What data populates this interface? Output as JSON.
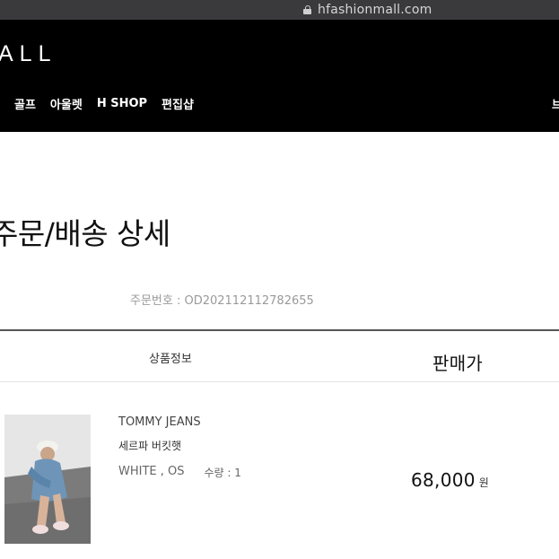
{
  "browser": {
    "url": "hfashionmall.com"
  },
  "header": {
    "logo": "ALL",
    "nav": [
      "골프",
      "아울렛",
      "H SHOP",
      "편집샵"
    ],
    "nav_right": "브"
  },
  "page": {
    "title": "주문/배송 상세",
    "order_number": "주문번호 : OD202112112782655"
  },
  "table": {
    "headers": {
      "product_info": "상품정보",
      "price": "판매가"
    }
  },
  "item": {
    "brand": "TOMMY JEANS",
    "name": "세르파 버킷햇",
    "option": "WHITE , OS",
    "quantity": "수량 : 1",
    "price": "68,000",
    "currency": "원"
  },
  "colors": {
    "header_bg": "#000000",
    "urlbar_bg": "#3a3a3c",
    "text": "#111111",
    "muted": "#9a9a9a"
  }
}
